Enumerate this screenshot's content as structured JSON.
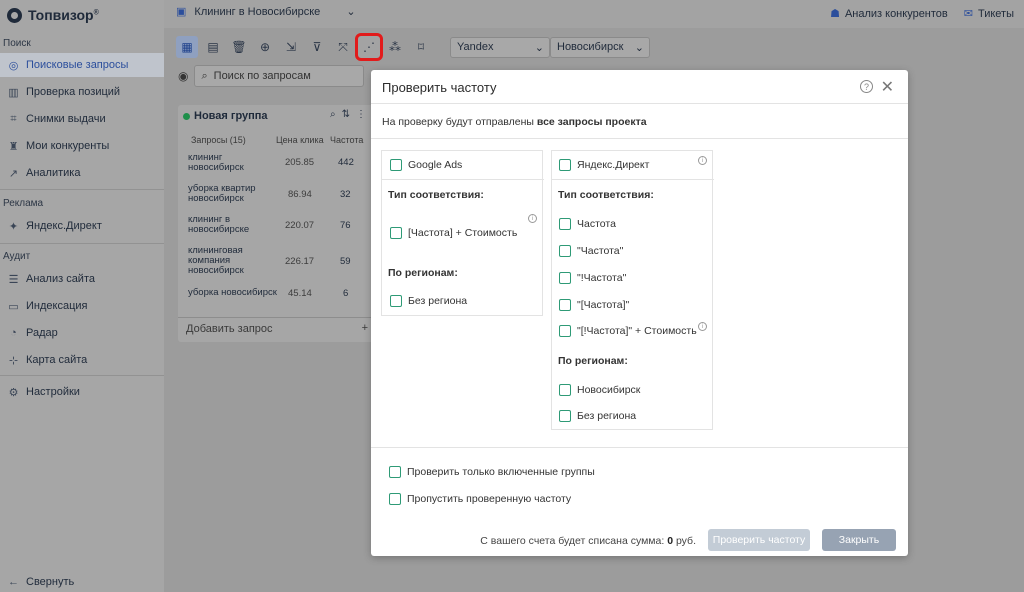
{
  "brand": {
    "name": "Топвизор",
    "reg": "®"
  },
  "sidebar": {
    "sections": [
      {
        "title": "Поиск"
      },
      {
        "title": "Реклама"
      },
      {
        "title": "Аудит"
      }
    ],
    "items": [
      {
        "label": "Поисковые запросы",
        "icon": "queries-icon"
      },
      {
        "label": "Проверка позиций",
        "icon": "bar-chart-icon"
      },
      {
        "label": "Снимки выдачи",
        "icon": "snapshot-icon"
      },
      {
        "label": "Мои конкуренты",
        "icon": "trophy-icon"
      },
      {
        "label": "Аналитика",
        "icon": "analytics-icon"
      },
      {
        "label": "Яндекс.Директ",
        "icon": "direct-icon"
      },
      {
        "label": "Анализ сайта",
        "icon": "site-analysis-icon"
      },
      {
        "label": "Индексация",
        "icon": "indexation-icon"
      },
      {
        "label": "Радар",
        "icon": "radar-icon"
      },
      {
        "label": "Карта сайта",
        "icon": "sitemap-icon"
      },
      {
        "label": "Настройки",
        "icon": "gear-icon"
      }
    ],
    "collapse": "Свернуть"
  },
  "topbar": {
    "project": "Клининг в Новосибирске",
    "competitors": "Анализ конкурентов",
    "tickets": "Тикеты"
  },
  "toolbar": {
    "engine": "Yandex",
    "region": "Новосибирск",
    "search_placeholder": "Поиск по запросам"
  },
  "group": {
    "name": "Новая группа",
    "col_queries": "Запросы (15)",
    "col_price": "Цена клика",
    "col_freq": "Частота",
    "rows": [
      {
        "query": "клининг новосибирск",
        "price": "205.85",
        "freq": "442"
      },
      {
        "query": "уборка квартир новосибирск",
        "price": "86.94",
        "freq": "32"
      },
      {
        "query": "клининг в новосибирске",
        "price": "220.07",
        "freq": "76"
      },
      {
        "query": "клининговая компания новосибирск",
        "price": "226.17",
        "freq": "59"
      },
      {
        "query": "уборка новосибирск",
        "price": "45.14",
        "freq": "6"
      }
    ],
    "add_query": "Добавить запрос"
  },
  "modal": {
    "title": "Проверить частоту",
    "info_prefix": "На проверку будут отправлены ",
    "info_bold": "все запросы проекта",
    "left": {
      "service": "Google Ads",
      "match_type_title": "Тип соответствия:",
      "match_option": "[Частота] + Стоимость",
      "regions_title": "По регионам:",
      "region_option": "Без региона"
    },
    "right": {
      "service": "Яндекс.Директ",
      "match_type_title": "Тип соответствия:",
      "match_options": [
        "Частота",
        "\"Частота\"",
        "\"!Частота\"",
        "\"[Частота]\"",
        "\"[!Частота]\" + Стоимость"
      ],
      "regions_title": "По регионам:",
      "region_options": [
        "Новосибирск",
        "Без региона"
      ]
    },
    "option_enabled_groups": "Проверить только включенные группы",
    "option_skip_checked": "Пропустить проверенную частоту",
    "cost_prefix": "С вашего счета будет списана сумма: ",
    "cost_value": "0",
    "cost_suffix": " руб.",
    "check_button": "Проверить частоту",
    "close_button": "Закрыть"
  }
}
